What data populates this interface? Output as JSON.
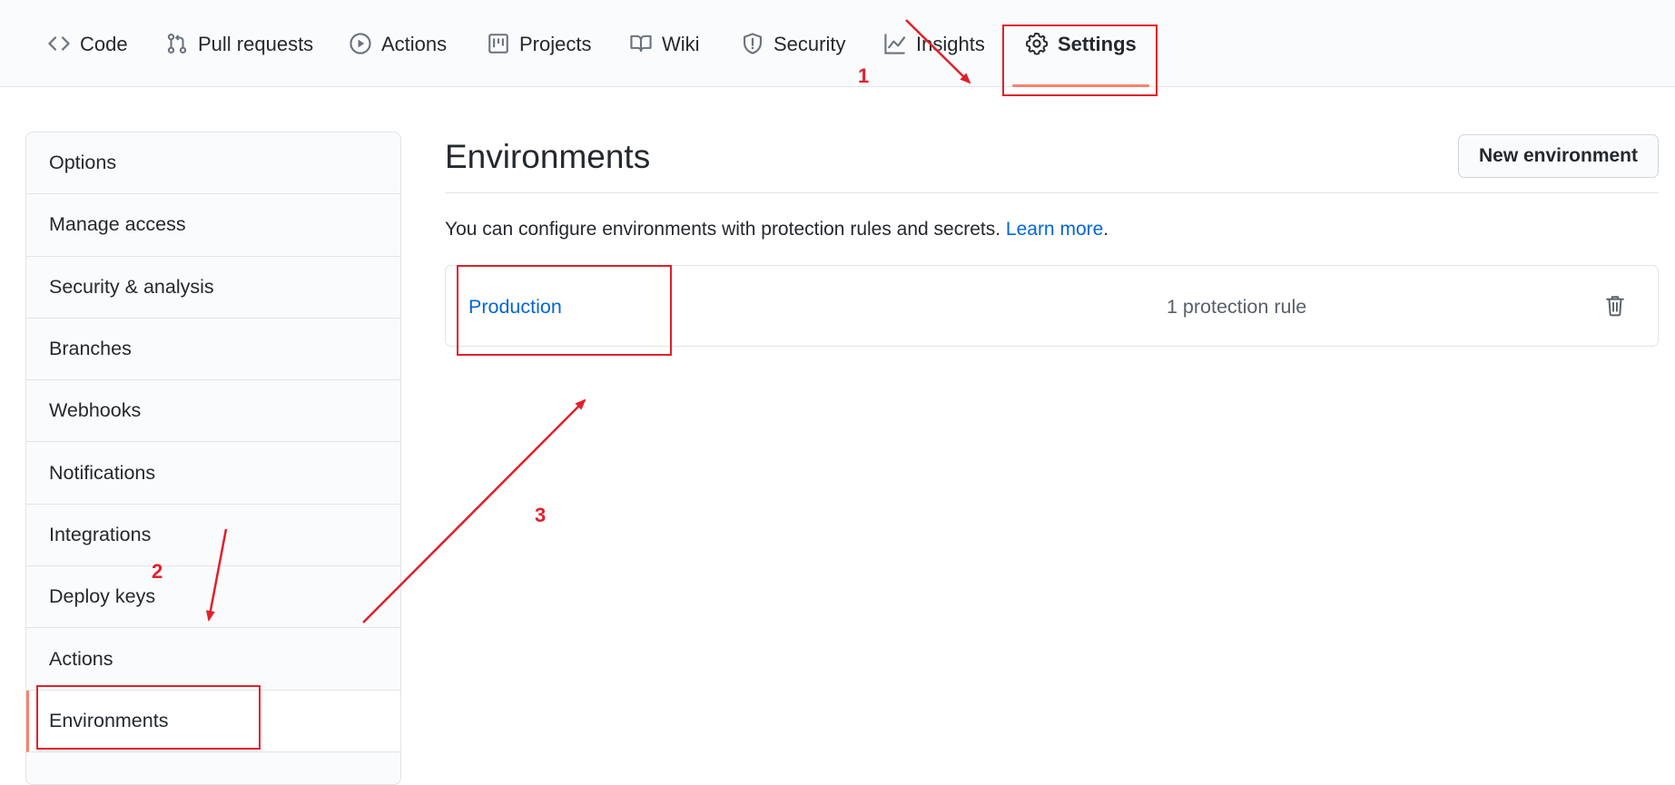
{
  "repo_nav": {
    "tabs": [
      {
        "label": "Code",
        "icon": "code-icon"
      },
      {
        "label": "Pull requests",
        "icon": "git-pull-request-icon"
      },
      {
        "label": "Actions",
        "icon": "play-icon"
      },
      {
        "label": "Projects",
        "icon": "project-icon"
      },
      {
        "label": "Wiki",
        "icon": "book-icon"
      },
      {
        "label": "Security",
        "icon": "shield-icon"
      },
      {
        "label": "Insights",
        "icon": "graph-icon"
      },
      {
        "label": "Settings",
        "icon": "gear-icon",
        "selected": true
      }
    ]
  },
  "sidebar": {
    "items": [
      {
        "label": "Options"
      },
      {
        "label": "Manage access"
      },
      {
        "label": "Security & analysis"
      },
      {
        "label": "Branches"
      },
      {
        "label": "Webhooks"
      },
      {
        "label": "Notifications"
      },
      {
        "label": "Integrations"
      },
      {
        "label": "Deploy keys"
      },
      {
        "label": "Actions"
      },
      {
        "label": "Environments",
        "selected": true
      }
    ]
  },
  "main": {
    "title": "Environments",
    "new_environment_label": "New environment",
    "description": "You can configure environments with protection rules and secrets. ",
    "learn_more": "Learn more",
    "description_end": ".",
    "environments": [
      {
        "name": "Production",
        "rules": "1 protection rule",
        "delete_icon": "trash-icon"
      }
    ]
  },
  "annotations": {
    "step1": "1",
    "step2": "2",
    "step3": "3",
    "color": "#e0202a"
  },
  "colors": {
    "accent_underline": "#f9826c",
    "link": "#0366d6"
  }
}
